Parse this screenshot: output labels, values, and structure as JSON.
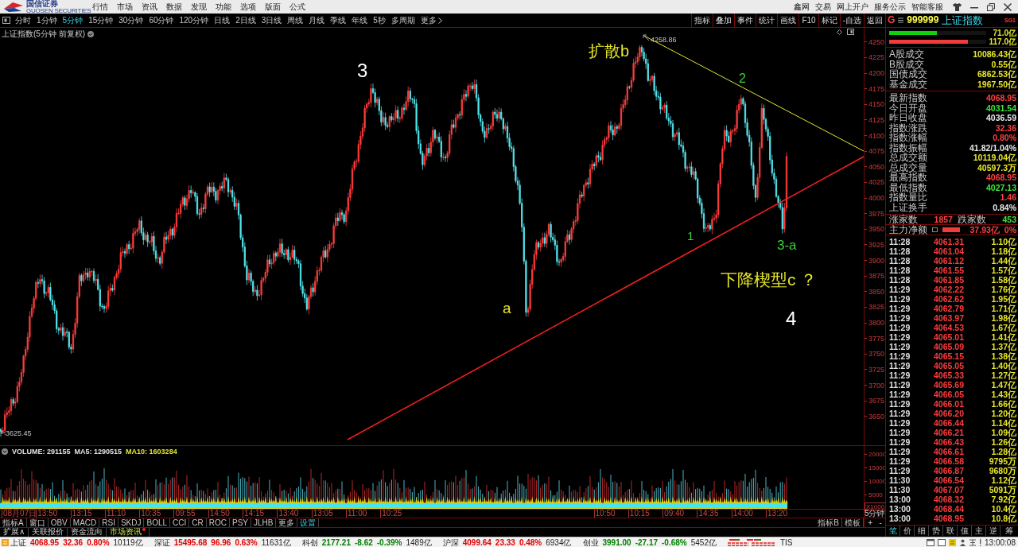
{
  "title_bar": {
    "brand": "国信证券",
    "brand_subtitle": "GUOSEN SECURITIES",
    "menu": [
      "行情",
      "市场",
      "资讯",
      "数据",
      "发现",
      "功能",
      "选项",
      "版面",
      "公式"
    ],
    "links": [
      "鑫网",
      "交易",
      "网上开户",
      "服务公示",
      "智能客服"
    ]
  },
  "period_bar": {
    "periods": [
      {
        "label": "分时",
        "selected": false
      },
      {
        "label": "1分钟",
        "selected": false
      },
      {
        "label": "5分钟",
        "selected": true
      },
      {
        "label": "15分钟",
        "selected": false
      },
      {
        "label": "30分钟",
        "selected": false
      },
      {
        "label": "60分钟",
        "selected": false
      },
      {
        "label": "120分钟",
        "selected": false
      },
      {
        "label": "日线",
        "selected": false
      },
      {
        "label": "2日线",
        "selected": false
      },
      {
        "label": "3日线",
        "selected": false
      },
      {
        "label": "周线",
        "selected": false
      },
      {
        "label": "月线",
        "selected": false
      },
      {
        "label": "季线",
        "selected": false
      },
      {
        "label": "年线",
        "selected": false
      },
      {
        "label": "5秒",
        "selected": false
      },
      {
        "label": "多周期",
        "selected": false
      }
    ],
    "more": "更多",
    "tools": [
      "指标",
      "叠加",
      "事件",
      "统计",
      "画线",
      "F10",
      "标记",
      "-自选",
      "返回"
    ]
  },
  "chart": {
    "title": "上证指数(5分钟 前复权)",
    "price_ticks": [
      "4250",
      "4225",
      "4200",
      "4175",
      "4150",
      "4125",
      "4100",
      "4075",
      "4050",
      "4025",
      "4000",
      "3975",
      "3950",
      "3925",
      "3900",
      "3875",
      "3850",
      "3825",
      "3800",
      "3775",
      "3750",
      "3725",
      "3700",
      "3675",
      "3650"
    ],
    "price_markers": [
      "4258.86",
      "3625.45"
    ],
    "annotations": [
      {
        "text": "扩散b",
        "color": "#e6e62a"
      },
      {
        "text": "3",
        "color": "#ffffff"
      },
      {
        "text": "2",
        "color": "#3cd23c"
      },
      {
        "text": "1",
        "color": "#3cd23c"
      },
      {
        "text": "3-a",
        "color": "#3cd23c"
      },
      {
        "text": "下降楔型c ？",
        "color": "#e6e62a"
      },
      {
        "text": "a",
        "color": "#e6e62a"
      },
      {
        "text": "4",
        "color": "#ffffff"
      }
    ]
  },
  "volume_pane": {
    "readouts": [
      {
        "text": "VOLUME: 291155",
        "color": "#e0e0e0"
      },
      {
        "text": "MA5: 1290515",
        "color": "#e0e0e0"
      },
      {
        "text": "MA10: 1603284",
        "color": "#e6e62a"
      }
    ],
    "ticks": [
      "20000",
      "15000",
      "10000",
      "5000"
    ],
    "unit": "X1000"
  },
  "time_axis": [
    "08月07日",
    "13:50",
    "13:15",
    "11:10",
    "10:35",
    "09:55",
    "14:50",
    "14:15",
    "13:40",
    "13:05",
    "11:00",
    "10:25",
    "10:50",
    "10:15",
    "09:40",
    "14:35",
    "14:00",
    "13:20"
  ],
  "axis_controls": {
    "period": "5分钟",
    "zoom": [
      "+",
      "-"
    ]
  },
  "indicator_bar": {
    "tabs": [
      {
        "label": "指标A",
        "kind": "tab"
      },
      {
        "label": "窗口",
        "kind": "tab"
      },
      {
        "label": "OBV",
        "kind": "tab"
      },
      {
        "label": "MACD",
        "kind": "tab"
      },
      {
        "label": "RSI",
        "kind": "tab"
      },
      {
        "label": "SKDJ",
        "kind": "tab"
      },
      {
        "label": "BOLL",
        "kind": "tab"
      },
      {
        "label": "CCI",
        "kind": "tab"
      },
      {
        "label": "CR",
        "kind": "tab"
      },
      {
        "label": "ROC",
        "kind": "tab"
      },
      {
        "label": "PSY",
        "kind": "tab"
      },
      {
        "label": "JLHB",
        "kind": "tab"
      },
      {
        "label": "更多",
        "kind": "tab"
      },
      {
        "label": "设置",
        "kind": "link"
      }
    ],
    "right_tabs": [
      "指标B",
      "模板"
    ]
  },
  "extension_bar": [
    {
      "label": "扩展∧",
      "selected": false,
      "alert": false
    },
    {
      "label": "关联报价",
      "selected": false,
      "alert": false
    },
    {
      "label": "资金流向",
      "selected": false,
      "alert": false
    },
    {
      "label": "市场资讯",
      "selected": true,
      "alert": true
    }
  ],
  "quote_panel": {
    "prefix": "G",
    "code": "999999",
    "name": "上证指数",
    "tag": "SG1",
    "flow_bars": [
      {
        "level": 0.49,
        "value": "71.0亿",
        "color": "#10d010"
      },
      {
        "level": 0.81,
        "value": "117.0亿",
        "color": "#f03c3c"
      }
    ],
    "turnover": [
      {
        "label": "A股成交",
        "value": "10086.43亿"
      },
      {
        "label": "B股成交",
        "value": "0.55亿"
      },
      {
        "label": "国债成交",
        "value": "6862.53亿"
      },
      {
        "label": "基金成交",
        "value": "1967.50亿"
      }
    ],
    "stats": [
      {
        "label": "最新指数",
        "value": "4068.95",
        "color": "#ff4040"
      },
      {
        "label": "今日开盘",
        "value": "4031.54",
        "color": "#3ce63c"
      },
      {
        "label": "昨日收盘",
        "value": "4036.59",
        "color": "#e8e8e8"
      },
      {
        "label": "指数涨跌",
        "value": "32.36",
        "color": "#ff4040"
      },
      {
        "label": "指数涨幅",
        "value": "0.80%",
        "color": "#ff4040"
      },
      {
        "label": "指数振幅",
        "value": "41.82/1.04%",
        "color": "#e8e8e8"
      },
      {
        "label": "总成交额",
        "value": "10119.04亿",
        "color": "#e6e62a"
      },
      {
        "label": "总成交量",
        "value": "40597.3万",
        "color": "#e6e62a"
      },
      {
        "label": "最高指数",
        "value": "4068.95",
        "color": "#ff4040"
      },
      {
        "label": "最低指数",
        "value": "4027.13",
        "color": "#3ce63c"
      },
      {
        "label": "指数量比",
        "value": "1.46",
        "color": "#ff4040"
      },
      {
        "label": "上证换手",
        "value": "0.84%",
        "color": "#e8e8e8"
      }
    ],
    "breadth": {
      "up_label": "涨家数",
      "up_count": "1857",
      "down_label": "跌家数",
      "down_count": "453"
    },
    "net_flow": {
      "label": "主力净额",
      "value": "37.93亿",
      "percent": "0%"
    },
    "ticks": [
      {
        "time": "11:28",
        "price": "4061.31",
        "volume": "1.10亿"
      },
      {
        "time": "11:28",
        "price": "4061.04",
        "volume": "1.18亿"
      },
      {
        "time": "11:28",
        "price": "4061.12",
        "volume": "1.44亿"
      },
      {
        "time": "11:28",
        "price": "4061.55",
        "volume": "1.57亿"
      },
      {
        "time": "11:28",
        "price": "4061.85",
        "volume": "1.58亿"
      },
      {
        "time": "11:29",
        "price": "4062.22",
        "volume": "1.76亿"
      },
      {
        "time": "11:29",
        "price": "4062.62",
        "volume": "1.95亿"
      },
      {
        "time": "11:29",
        "price": "4062.79",
        "volume": "1.71亿"
      },
      {
        "time": "11:29",
        "price": "4063.97",
        "volume": "1.98亿"
      },
      {
        "time": "11:29",
        "price": "4064.53",
        "volume": "1.67亿"
      },
      {
        "time": "11:29",
        "price": "4065.01",
        "volume": "1.41亿"
      },
      {
        "time": "11:29",
        "price": "4065.09",
        "volume": "1.37亿"
      },
      {
        "time": "11:29",
        "price": "4065.15",
        "volume": "1.38亿"
      },
      {
        "time": "11:29",
        "price": "4065.05",
        "volume": "1.40亿"
      },
      {
        "time": "11:29",
        "price": "4065.33",
        "volume": "1.27亿"
      },
      {
        "time": "11:29",
        "price": "4065.69",
        "volume": "1.47亿"
      },
      {
        "time": "11:29",
        "price": "4066.05",
        "volume": "1.43亿"
      },
      {
        "time": "11:29",
        "price": "4066.01",
        "volume": "1.66亿"
      },
      {
        "time": "11:29",
        "price": "4066.20",
        "volume": "1.20亿"
      },
      {
        "time": "11:29",
        "price": "4066.44",
        "volume": "1.14亿"
      },
      {
        "time": "11:29",
        "price": "4066.21",
        "volume": "1.09亿"
      },
      {
        "time": "11:29",
        "price": "4066.43",
        "volume": "1.26亿"
      },
      {
        "time": "11:29",
        "price": "4066.61",
        "volume": "1.28亿"
      },
      {
        "time": "11:29",
        "price": "4066.58",
        "volume": "9795万"
      },
      {
        "time": "11:29",
        "price": "4066.87",
        "volume": "9680万"
      },
      {
        "time": "11:30",
        "price": "4066.54",
        "volume": "1.12亿"
      },
      {
        "time": "11:30",
        "price": "4067.07",
        "volume": "5091万"
      },
      {
        "time": "13:00",
        "price": "4068.32",
        "volume": "7.92亿"
      },
      {
        "time": "13:00",
        "price": "4068.44",
        "volume": "10.4亿"
      },
      {
        "time": "13:00",
        "price": "4068.95",
        "volume": "10.8亿"
      }
    ],
    "tabs": [
      {
        "label": "笔",
        "selected": true
      },
      {
        "label": "价",
        "selected": false
      },
      {
        "label": "细",
        "selected": false
      },
      {
        "label": "势",
        "selected": false
      },
      {
        "label": "联",
        "selected": false
      },
      {
        "label": "值",
        "selected": false
      },
      {
        "label": "主",
        "selected": false
      },
      {
        "label": "逆",
        "selected": false
      },
      {
        "label": "筹",
        "selected": false
      }
    ]
  },
  "status_bar": {
    "indices": [
      {
        "name": "上证",
        "value": "4068.95",
        "change": "32.36",
        "percent": "0.80%",
        "amount": "10119亿",
        "color": "#e00000"
      },
      {
        "name": "深证",
        "value": "15495.68",
        "change": "96.96",
        "percent": "0.63%",
        "amount": "11631亿",
        "color": "#e00000"
      },
      {
        "name": "科创",
        "value": "2177.21",
        "change": "-8.62",
        "percent": "-0.39%",
        "amount": "1489亿",
        "color": "#008000"
      },
      {
        "name": "沪深",
        "value": "4099.64",
        "change": "23.33",
        "percent": "0.48%",
        "amount": "6934亿",
        "color": "#e00000"
      },
      {
        "name": "创业",
        "value": "3991.00",
        "change": "-27.17",
        "percent": "-0.68%",
        "amount": "5452亿",
        "color": "#008000"
      }
    ],
    "feed": "TIS",
    "clock": "13:00:08"
  }
}
